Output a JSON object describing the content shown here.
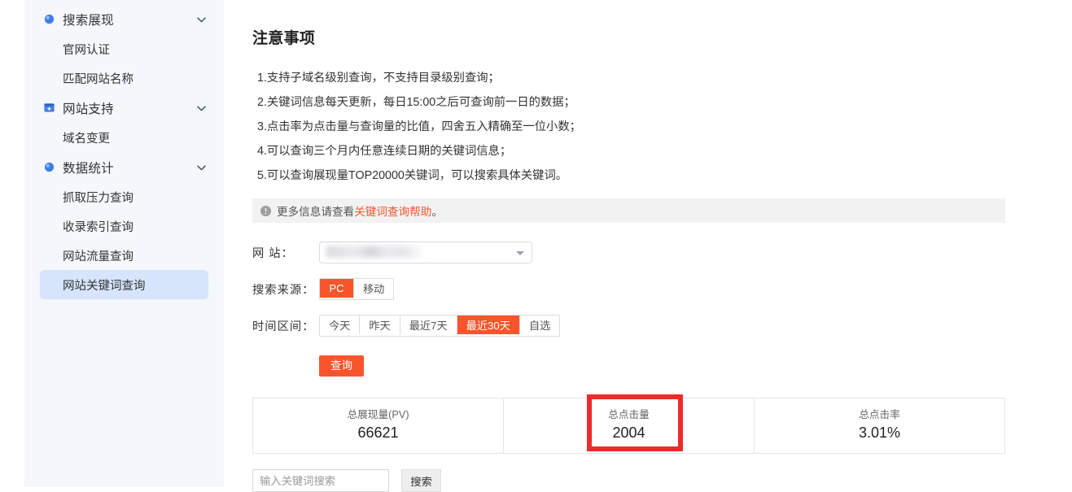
{
  "sidebar": {
    "groups": [
      {
        "label": "搜索展现",
        "icon": "search-display-icon",
        "chevron": "chevron-down-icon",
        "items": [
          {
            "label": "官网认证",
            "active": false
          },
          {
            "label": "匹配网站名称",
            "active": false
          }
        ]
      },
      {
        "label": "网站支持",
        "icon": "site-support-icon",
        "chevron": "chevron-down-icon",
        "items": [
          {
            "label": "域名变更",
            "active": false
          }
        ]
      },
      {
        "label": "数据统计",
        "icon": "data-stats-icon",
        "chevron": "chevron-down-icon",
        "items": [
          {
            "label": "抓取压力查询",
            "active": false
          },
          {
            "label": "收录索引查询",
            "active": false
          },
          {
            "label": "网站流量查询",
            "active": false
          },
          {
            "label": "网站关键词查询",
            "active": true
          }
        ]
      }
    ]
  },
  "main": {
    "title": "注意事项",
    "notes": [
      "1.支持子域名级别查询，不支持目录级别查询；",
      "2.关键词信息每天更新，每日15:00之后可查询前一日的数据；",
      "3.点击率为点击量与查询量的比值，四舍五入精确至一位小数；",
      "4.可以查询三个月内任意连续日期的关键词信息；",
      "5.可以查询展现量TOP20000关键词，可以搜索具体关键词。"
    ],
    "notice": {
      "icon": "info-circle-icon",
      "prefix": "更多信息请查看",
      "link": "关键词查询帮助",
      "suffix": "。"
    },
    "form": {
      "site": {
        "label": "网 站：",
        "value": "",
        "caret": "chevron-down-icon"
      },
      "source": {
        "label": "搜索来源：",
        "options": [
          {
            "label": "PC",
            "active": true
          },
          {
            "label": "移动",
            "active": false
          }
        ]
      },
      "range": {
        "label": "时间区间：",
        "options": [
          {
            "label": "今天",
            "active": false
          },
          {
            "label": "昨天",
            "active": false
          },
          {
            "label": "最近7天",
            "active": false
          },
          {
            "label": "最近30天",
            "active": true
          },
          {
            "label": "自选",
            "active": false
          }
        ]
      },
      "query_button": "查询"
    },
    "stats": [
      {
        "label": "总展现量(PV)",
        "value": "66621",
        "highlighted": false
      },
      {
        "label": "总点击量",
        "value": "2004",
        "highlighted": true
      },
      {
        "label": "总点击率",
        "value": "3.01%",
        "highlighted": false
      }
    ],
    "search": {
      "placeholder": "输入关键词搜索",
      "value": "",
      "button": "搜索"
    }
  },
  "colors": {
    "accent": "#f8552c",
    "sidebar_bg": "#f4f7fb",
    "active_item_bg": "#d6e5fb",
    "highlight_box": "#ee2b2b",
    "notice_bg": "#f2f2f2"
  }
}
